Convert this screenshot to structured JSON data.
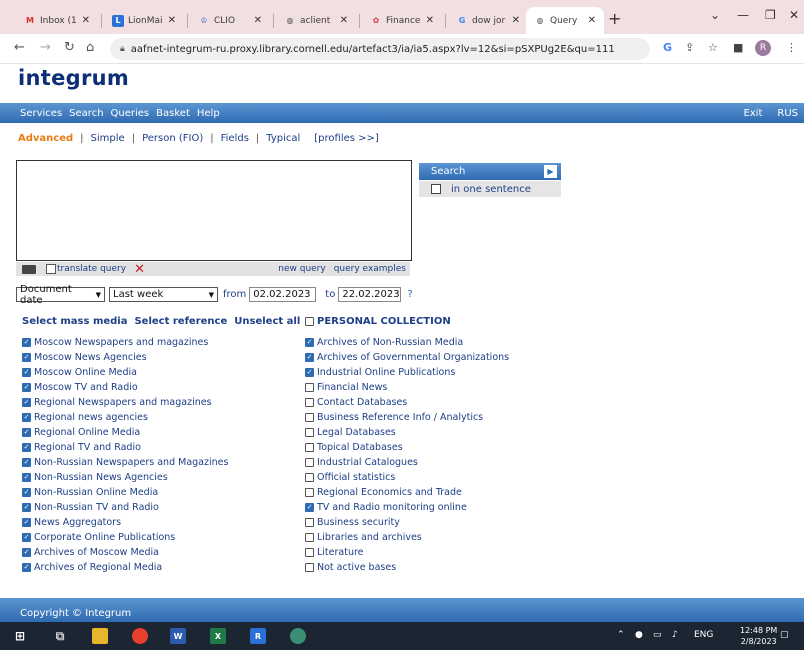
{
  "browser": {
    "tabs": [
      {
        "label": "Inbox (1",
        "icon": "gmail-icon"
      },
      {
        "label": "LionMai",
        "icon": "lionmail-icon"
      },
      {
        "label": "CLIO",
        "icon": "clio-icon"
      },
      {
        "label": "aclient",
        "icon": "globe-icon"
      },
      {
        "label": "Finance",
        "icon": "finance-icon"
      },
      {
        "label": "dow jor",
        "icon": "google-icon"
      },
      {
        "label": "Query",
        "icon": "globe-icon"
      }
    ],
    "url": "aafnet-integrum-ru.proxy.library.cornell.edu/artefact3/ia/ia5.aspx?lv=12&si=pSXPUg2E&qu=111",
    "profile_initial": "R"
  },
  "site": {
    "logo": "integrum",
    "menu": [
      "Services",
      "Search",
      "Queries",
      "Basket",
      "Help"
    ],
    "menu_right": [
      "Exit",
      "RUS"
    ],
    "modes": [
      "Advanced",
      "Simple",
      "Person (FIO)",
      "Fields",
      "Typical"
    ],
    "profiles_link": "[profiles >>]",
    "query_value": "",
    "translate_label": "translate query",
    "new_query": "new query",
    "query_examples": "query examples",
    "search_label": "Search",
    "one_sentence": "in one sentence",
    "date_type": "Document date",
    "period": "Last week",
    "from_label": "from",
    "from_date": "02.02.2023",
    "to_label": "to",
    "to_date": "22.02.2023",
    "help_mark": "?",
    "select_mass_media": "Select mass media",
    "select_reference": "Select reference",
    "unselect_all": "Unselect all",
    "personal_collection": "PERSONAL COLLECTION",
    "left_sources": [
      {
        "label": "Moscow Newspapers and magazines",
        "checked": true
      },
      {
        "label": "Moscow News Agencies",
        "checked": true
      },
      {
        "label": "Moscow Online Media",
        "checked": true
      },
      {
        "label": "Moscow TV and Radio",
        "checked": true
      },
      {
        "label": "Regional Newspapers and magazines",
        "checked": true
      },
      {
        "label": "Regional news agencies",
        "checked": true
      },
      {
        "label": "Regional Online Media",
        "checked": true
      },
      {
        "label": "Regional TV and Radio",
        "checked": true
      },
      {
        "label": "Non-Russian Newspapers and Magazines",
        "checked": true
      },
      {
        "label": "Non-Russian News Agencies",
        "checked": true
      },
      {
        "label": "Non-Russian Online Media",
        "checked": true
      },
      {
        "label": "Non-Russian TV and Radio",
        "checked": true
      },
      {
        "label": "News Aggregators",
        "checked": true
      },
      {
        "label": "Corporate Online Publications",
        "checked": true
      },
      {
        "label": "Archives of Moscow Media",
        "checked": true
      },
      {
        "label": "Archives of Regional Media",
        "checked": true
      }
    ],
    "right_sources": [
      {
        "label": "Archives of Non-Russian Media",
        "checked": true
      },
      {
        "label": "Archives of Governmental Organizations",
        "checked": true
      },
      {
        "label": "Industrial Online Publications",
        "checked": true
      },
      {
        "label": "Financial News",
        "checked": false
      },
      {
        "label": "Contact Databases",
        "checked": false
      },
      {
        "label": "Business Reference Info / Analytics",
        "checked": false
      },
      {
        "label": "Legal Databases",
        "checked": false
      },
      {
        "label": "Topical Databases",
        "checked": false
      },
      {
        "label": "Industrial Catalogues",
        "checked": false
      },
      {
        "label": "Official statistics",
        "checked": false
      },
      {
        "label": "Regional Economics and Trade",
        "checked": false
      },
      {
        "label": "TV and Radio monitoring online",
        "checked": true
      },
      {
        "label": "Business security",
        "checked": false
      },
      {
        "label": "Libraries and archives",
        "checked": false
      },
      {
        "label": "Literature",
        "checked": false
      },
      {
        "label": "Not active bases",
        "checked": false
      }
    ],
    "footer": "Copyright © Integrum"
  },
  "taskbar": {
    "lang": "ENG",
    "time": "12:48 PM",
    "date": "2/8/2023"
  }
}
